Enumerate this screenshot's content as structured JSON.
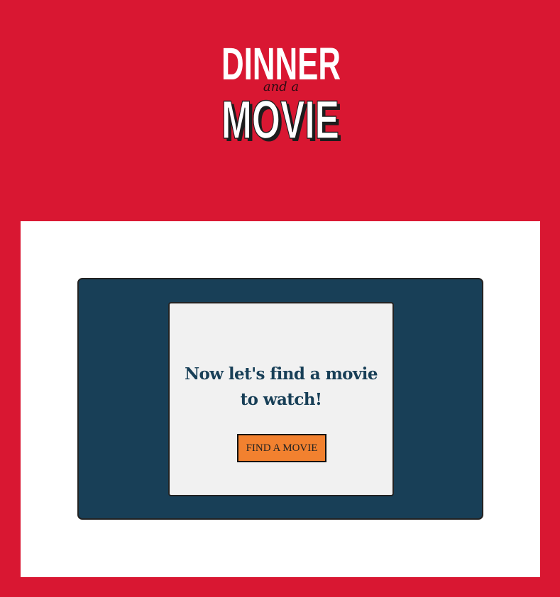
{
  "header": {
    "logo": {
      "top_text": "DINNER",
      "middle_text": "and a",
      "bottom_text": "MOVIE"
    }
  },
  "card": {
    "prompt_line1": "Now let's find a movie",
    "prompt_line2": "to watch!",
    "button_label": "FIND A MOVIE"
  },
  "colors": {
    "background_red": "#d91732",
    "panel_white": "#ffffff",
    "card_navy": "#183f57",
    "inner_card_gray": "#f1f1f1",
    "button_orange": "#f2812f",
    "border_dark": "#222222"
  },
  "icons": {
    "logo": "dinner-and-a-movie-logo"
  }
}
